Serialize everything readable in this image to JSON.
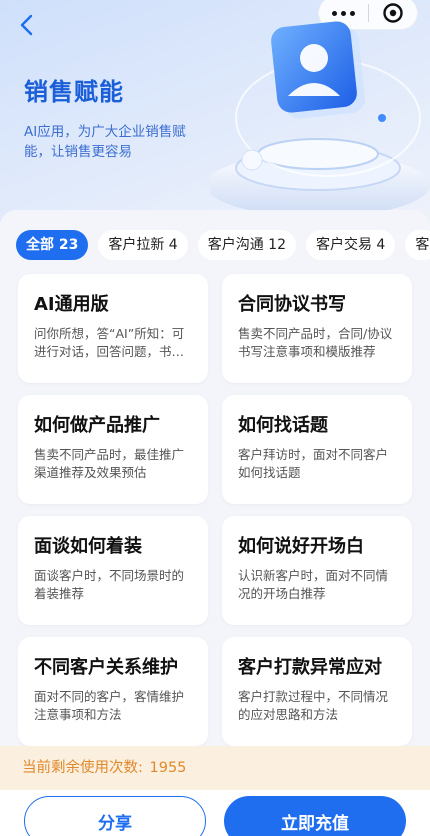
{
  "nav": {
    "back_icon": "chevron-left-icon",
    "more_icon": "more-dots-icon",
    "target_icon": "target-icon"
  },
  "hero": {
    "title": "销售赋能",
    "description": "AI应用，为广大企业销售赋能，让销售更容易",
    "illustration_icon": "user-profile-icon"
  },
  "tabs": [
    {
      "label": "全部 23",
      "active": true
    },
    {
      "label": "客户拉新 4",
      "active": false
    },
    {
      "label": "客户沟通 12",
      "active": false
    },
    {
      "label": "客户交易 4",
      "active": false
    },
    {
      "label": "客",
      "active": false
    }
  ],
  "cards": [
    {
      "title": "AI通用版",
      "desc": "问你所想，答“AI”所知：可进行对话，回答问题，书…"
    },
    {
      "title": "合同协议书写",
      "desc": "售卖不同产品时，合同/协议书写注意事项和模版推荐"
    },
    {
      "title": "如何做产品推广",
      "desc": "售卖不同产品时，最佳推广渠道推荐及效果预估"
    },
    {
      "title": "如何找话题",
      "desc": "客户拜访时，面对不同客户如何找话题"
    },
    {
      "title": "面谈如何着装",
      "desc": "面谈客户时，不同场景时的着装推荐"
    },
    {
      "title": "如何说好开场白",
      "desc": "认识新客户时，面对不同情况的开场白推荐"
    },
    {
      "title": "不同客户关系维护",
      "desc": "面对不同的客户，客情维护注意事项和方法"
    },
    {
      "title": "客户打款异常应对",
      "desc": "客户打款过程中，不同情况的应对思路和方法"
    }
  ],
  "quota": {
    "label": "当前剩余使用次数:",
    "value": "1955"
  },
  "actions": {
    "share_label": "分享",
    "recharge_label": "立即充值"
  },
  "colors": {
    "accent": "#1f6ef0",
    "title_blue": "#1a5ed8",
    "quota_text": "#e0892a",
    "quota_bg": "#fbefdf"
  }
}
